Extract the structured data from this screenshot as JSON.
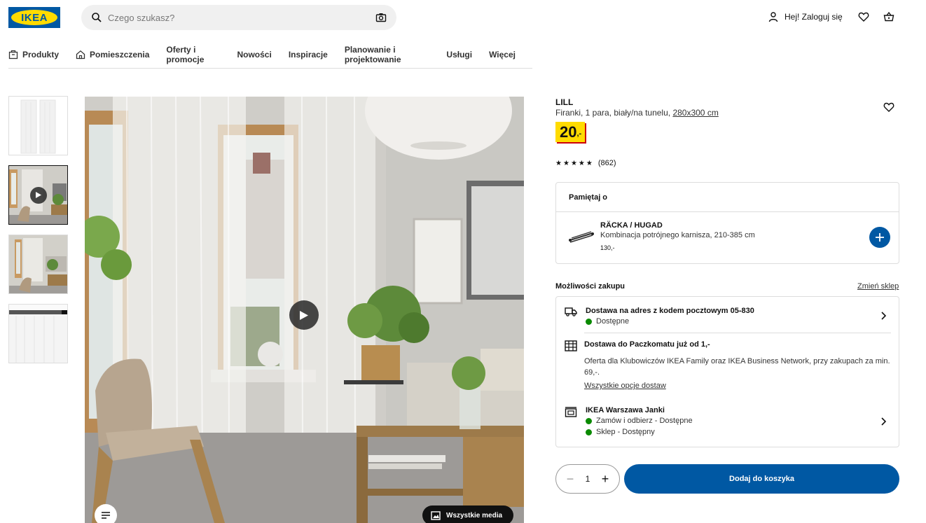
{
  "brand": {
    "logo_text": "IKEA"
  },
  "search": {
    "placeholder": "Czego szukasz?"
  },
  "account": {
    "label": "Hej! Zaloguj się"
  },
  "nav": {
    "items": [
      {
        "label": "Produkty",
        "icon": "box-icon"
      },
      {
        "label": "Pomieszczenia",
        "icon": "house-icon"
      },
      {
        "label": "Oferty i promocje"
      },
      {
        "label": "Nowości"
      },
      {
        "label": "Inspiracje"
      },
      {
        "label": "Planowanie i projektowanie"
      },
      {
        "label": "Usługi"
      },
      {
        "label": "Więcej"
      }
    ]
  },
  "gallery": {
    "all_media_label": "Wszystkie media"
  },
  "product": {
    "name": "LILL",
    "description": "Firanki, 1 para, biały/na tunelu,",
    "size": "280x300 cm",
    "price_int": "20",
    "price_dec": ",-",
    "rating_count": "(862)",
    "stars": 5
  },
  "remember": {
    "title": "Pamiętaj o",
    "item_name": "RÄCKA / HUGAD",
    "item_desc": "Kombinacja potrójnego karnisza, 210-385 cm",
    "item_price": "130,-"
  },
  "purchase": {
    "title": "Możliwości zakupu",
    "change_store": "Zmień sklep",
    "delivery_label": "Dostawa na adres z kodem pocztowym 05-830",
    "delivery_status": "Dostępne",
    "parcel_label": "Dostawa do Paczkomatu już od 1,-",
    "parcel_text": "Oferta dla Klubowiczów IKEA Family oraz IKEA Business Network, przy zakupach za min. 69,-.",
    "parcel_link": "Wszystkie opcje dostaw",
    "store_label": "IKEA Warszawa Janki",
    "store_status_1": "Zamów i odbierz - Dostępne",
    "store_status_2": "Sklep - Dostępny"
  },
  "cart": {
    "quantity": "1",
    "button_label": "Dodaj do koszyka"
  },
  "colors": {
    "ikea_blue": "#0058a3",
    "ikea_yellow": "#ffdb00",
    "price_red": "#cc0008",
    "available_green": "#0a8a00"
  }
}
